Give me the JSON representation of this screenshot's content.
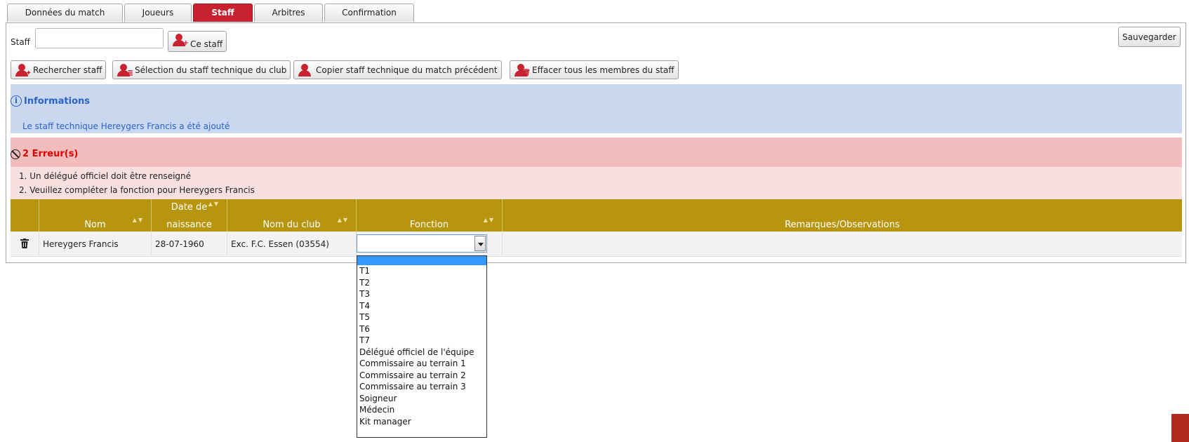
{
  "tabs": [
    {
      "label": "Données du match",
      "active": false
    },
    {
      "label": "Joueurs",
      "active": false
    },
    {
      "label": "Staff",
      "active": true
    },
    {
      "label": "Arbitres",
      "active": false
    },
    {
      "label": "Confirmation",
      "active": false
    }
  ],
  "staff_field": {
    "label": "Staff",
    "value": "",
    "add_button": "Ce staff"
  },
  "save_button": "Sauvegarder",
  "actions": {
    "search": "Rechercher staff",
    "select_club": "Sélection du staff technique du club",
    "copy_previous": "Copier staff technique du match précédent",
    "clear_all": "Effacer tous les membres du staff"
  },
  "info": {
    "title": "Informations",
    "message": "Le staff technique Hereygers Francis a été ajouté"
  },
  "errors": {
    "title": "2 Erreur(s)",
    "items": [
      "1. Un délégué officiel doit être renseigné",
      "2. Veuillez compléter la fonction pour Hereygers Francis"
    ]
  },
  "table": {
    "headers": {
      "nom": "Nom",
      "date_line1": "Date de",
      "date_line2": "naissance",
      "club": "Nom du club",
      "fonction": "Fonction",
      "remarques": "Remarques/Observations"
    },
    "rows": [
      {
        "nom": "Hereygers Francis",
        "date": "28-07-1960",
        "club": "Exc. F.C. Essen (03554)",
        "fonction": "",
        "remarques": ""
      }
    ]
  },
  "fonction_options": [
    "",
    "T1",
    "T2",
    "T3",
    "T4",
    "T5",
    "T6",
    "T7",
    "Délégué officiel de l'équipe",
    "Commissaire au terrain 1",
    "Commissaire au terrain 2",
    "Commissaire au terrain 3",
    "Soigneur",
    "Médecin",
    "Kit manager"
  ],
  "colors": {
    "accent": "#c8212f",
    "header": "#b8950e",
    "info": "#c9d7ef",
    "error": "#f0bcbc"
  }
}
